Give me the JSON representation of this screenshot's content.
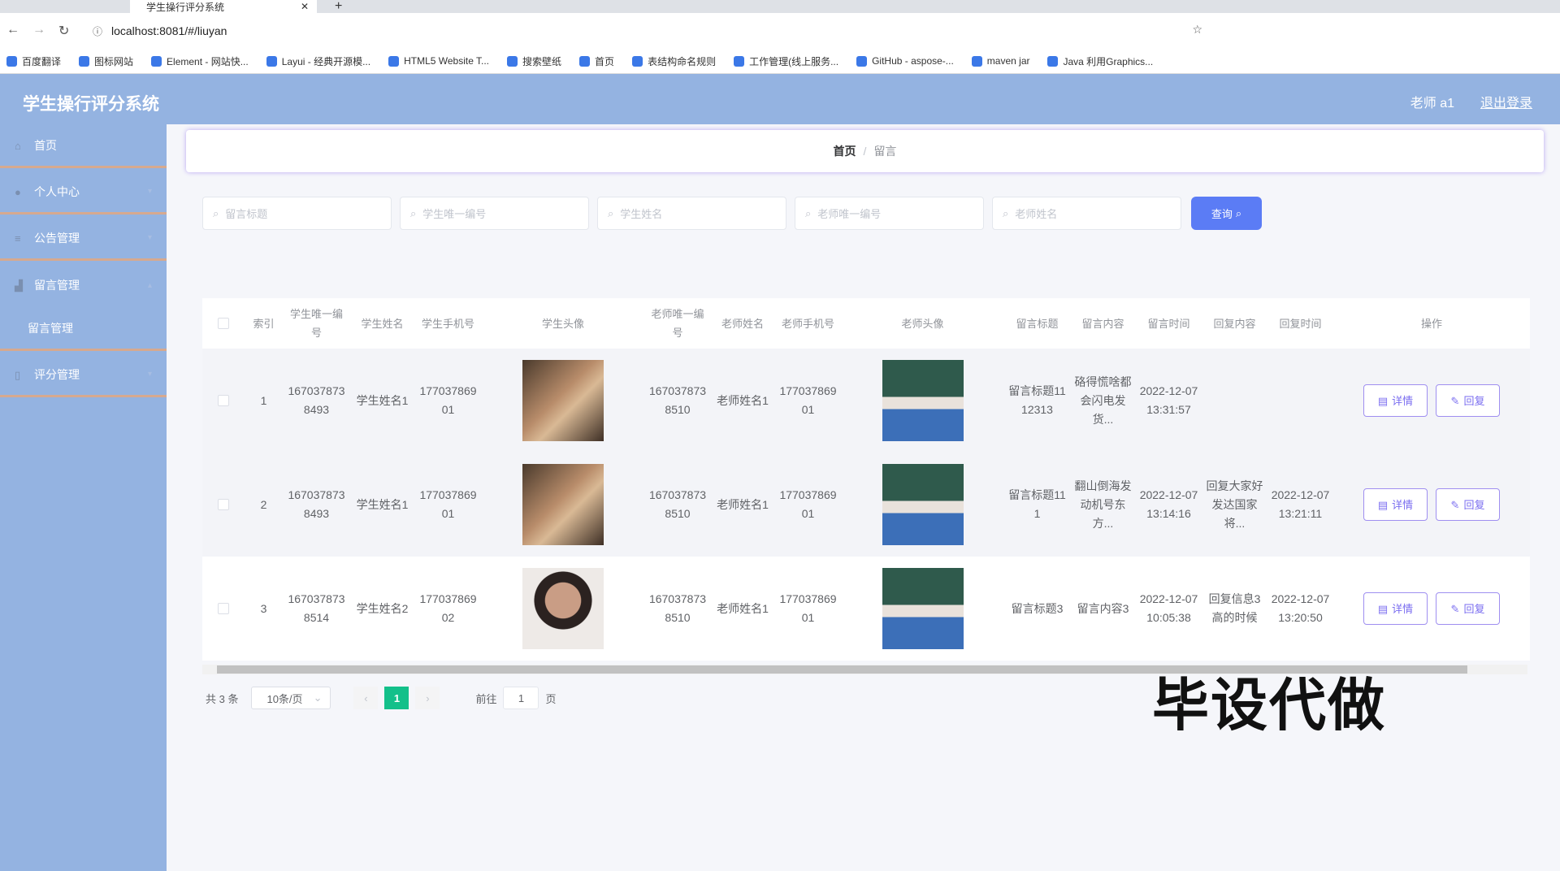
{
  "browser": {
    "tab_title": "学生操行评分系统",
    "url": "localhost:8081/#/liuyan",
    "bookmarks": [
      "百度翻译",
      "图标网站",
      "Element - 网站快...",
      "Layui - 经典开源模...",
      "HTML5 Website T...",
      "搜索壁纸",
      "首页",
      "表结构命名规则",
      "工作管理(线上服务...",
      "GitHub - aspose-...",
      "maven jar",
      "Java 利用Graphics..."
    ]
  },
  "header": {
    "title": "学生操行评分系统",
    "user": "老师 a1",
    "logout": "退出登录"
  },
  "sidebar": {
    "items": [
      {
        "label": "首页",
        "icon": "home-icon"
      },
      {
        "label": "个人中心",
        "icon": "user-icon"
      },
      {
        "label": "公告管理",
        "icon": "list-icon"
      },
      {
        "label": "留言管理",
        "icon": "chart-icon"
      },
      {
        "label": "留言管理",
        "icon": ""
      },
      {
        "label": "评分管理",
        "icon": "clipboard-icon"
      }
    ]
  },
  "breadcrumb": {
    "home": "首页",
    "sep": "/",
    "current": "留言"
  },
  "search": {
    "placeholders": [
      "留言标题",
      "学生唯一编号",
      "学生姓名",
      "老师唯一编号",
      "老师姓名"
    ],
    "button": "查询"
  },
  "table": {
    "headers": [
      "索引",
      "学生唯一编号",
      "学生姓名",
      "学生手机号",
      "学生头像",
      "老师唯一编号",
      "老师姓名",
      "老师手机号",
      "老师头像",
      "留言标题",
      "留言内容",
      "留言时间",
      "回复内容",
      "回复时间",
      "操作"
    ],
    "rows": [
      [
        "1",
        "1670378738493",
        "学生姓名1",
        "17703786901",
        "",
        "1670378738510",
        "老师姓名1",
        "17703786901",
        "",
        "留言标题1112313",
        "硌得慌啥都会闪电发货...",
        "2022-12-07 13:31:57",
        "",
        ""
      ],
      [
        "2",
        "1670378738493",
        "学生姓名1",
        "17703786901",
        "",
        "1670378738510",
        "老师姓名1",
        "17703786901",
        "",
        "留言标题111",
        "翻山倒海发动机号东方...",
        "2022-12-07 13:14:16",
        "回复大家好发达国家将...",
        "2022-12-07 13:21:11"
      ],
      [
        "3",
        "1670378738514",
        "学生姓名2",
        "17703786902",
        "",
        "1670378738510",
        "老师姓名1",
        "17703786901",
        "",
        "留言标题3",
        "留言内容3",
        "2022-12-07 10:05:38",
        "回复信息3高的时候",
        "2022-12-07 13:20:50"
      ]
    ],
    "actions": {
      "detail": "详情",
      "reply": "回复"
    }
  },
  "pagination": {
    "total": "共 3 条",
    "page_size": "10条/页",
    "current": "1",
    "goto_label": "前往",
    "goto_value": "1",
    "page_suffix": "页"
  },
  "watermark": "毕设代做"
}
